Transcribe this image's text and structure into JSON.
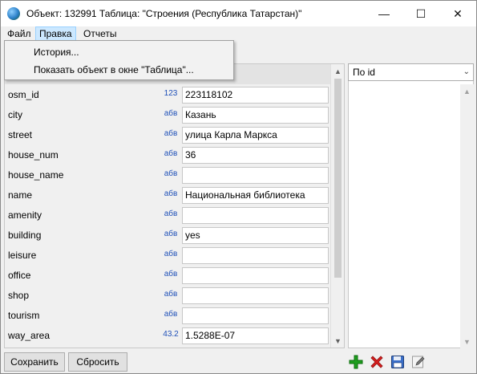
{
  "window": {
    "title": "Объект: 132991 Таблица: \"Строения (Республика Татарстан)\"",
    "minimize_glyph": "—",
    "maximize_glyph": "☐",
    "close_glyph": "✕"
  },
  "menu": {
    "items": [
      {
        "label": "Файл"
      },
      {
        "label": "Правка",
        "active": true
      },
      {
        "label": "Отчеты"
      }
    ],
    "dropdown": [
      {
        "label": "История..."
      },
      {
        "label": "Показать объект в окне \"Таблица\"..."
      }
    ]
  },
  "attributes": [
    {
      "name": "osm_id",
      "type": "123",
      "value": "223118102"
    },
    {
      "name": "city",
      "type": "абв",
      "value": "Казань"
    },
    {
      "name": "street",
      "type": "абв",
      "value": "улица Карла Маркса"
    },
    {
      "name": "house_num",
      "type": "абв",
      "value": "36"
    },
    {
      "name": "house_name",
      "type": "абв",
      "value": ""
    },
    {
      "name": "name",
      "type": "абв",
      "value": "Национальная библиотека"
    },
    {
      "name": "amenity",
      "type": "абв",
      "value": ""
    },
    {
      "name": "building",
      "type": "абв",
      "value": "yes"
    },
    {
      "name": "leisure",
      "type": "абв",
      "value": ""
    },
    {
      "name": "office",
      "type": "абв",
      "value": ""
    },
    {
      "name": "shop",
      "type": "абв",
      "value": ""
    },
    {
      "name": "tourism",
      "type": "абв",
      "value": ""
    },
    {
      "name": "way_area",
      "type": "43.2",
      "value": "1.5288E-07"
    }
  ],
  "right_panel": {
    "sort_select": "По id"
  },
  "buttons": {
    "save": "Сохранить",
    "reset": "Сбросить"
  },
  "toolbar_icons": [
    "add-icon",
    "delete-icon",
    "save-disk-icon",
    "edit-pencil-icon"
  ],
  "colors": {
    "menu_active_bg": "#cce8ff",
    "type_text": "#1f50b8",
    "add_green": "#1e9e1e",
    "delete_red": "#d81e1e"
  }
}
